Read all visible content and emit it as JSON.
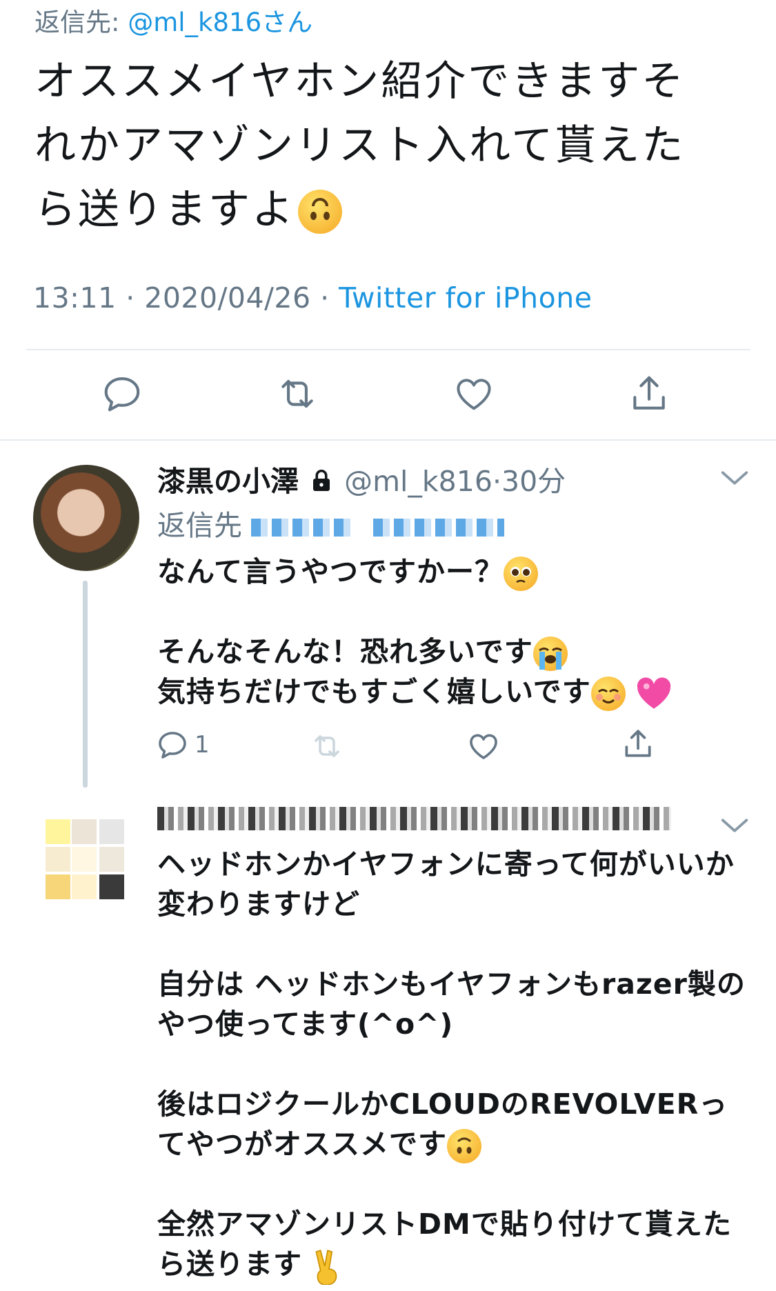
{
  "main_tweet": {
    "reply_to_prefix": "返信先: ",
    "reply_to_handle": "@ml_k816さん",
    "text": "オススメイヤホン紹介できますそれかアマゾンリスト入れて貰えたら送りますよ",
    "emoji": "upside-down-face",
    "time": "13:11 · 2020/04/26 · ",
    "client": "Twitter for iPhone"
  },
  "actions": {
    "reply_icon": "reply-icon",
    "retweet_icon": "retweet-icon",
    "like_icon": "heart-icon",
    "share_icon": "share-icon"
  },
  "reply1": {
    "name": "漆黒の小澤",
    "lock_icon": "lock-icon",
    "handle": "@ml_k816",
    "separator": "·",
    "age": "30分",
    "reply_to_prefix": "返信先",
    "line1": "なんて言うやつですかー？",
    "line2": "そんなそんな！恐れ多いです",
    "line3": "気持ちだけでもすごく嬉しいです",
    "reply_count": "1"
  },
  "reply2": {
    "para1": "ヘッドホンかイヤフォンに寄って何がいいか変わりますけど",
    "para2": "自分は ヘッドホンもイヤフォンもrazer製のやつ使ってます(^o^)",
    "para3": "後はロジクールかCLOUDのREVOLVERってやつがオススメです",
    "para4": "全然アマゾンリストDMで貼り付けて貰えたら送ります"
  },
  "colors": {
    "link_blue": "#1b95e0",
    "secondary_gray": "#657786",
    "divider": "#e6ecf0",
    "text": "#14171a"
  }
}
